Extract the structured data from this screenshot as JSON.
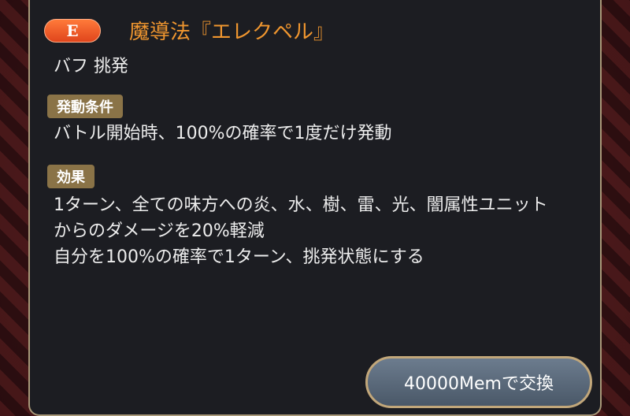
{
  "skill": {
    "rank": "E",
    "name": "魔導法『エレクペル』",
    "tags": "バフ 挑発"
  },
  "condition": {
    "label": "発動条件",
    "lines": [
      "バトル開始時、100%の確率で1度だけ発動"
    ]
  },
  "effect": {
    "label": "効果",
    "lines": [
      "1ターン、全ての味方への炎、水、樹、雷、光、闇属性ユニット",
      "からのダメージを20%軽減",
      "自分を100%の確率で1ターン、挑発状態にする"
    ]
  },
  "exchange_button": {
    "label": "40000Memで交換"
  },
  "colors": {
    "skill_name": "#f0962f",
    "rank_badge": "#e0451c",
    "section_label_bg": "#8a7347",
    "panel_bg": "#1c1d22",
    "panel_border": "#a89878"
  }
}
